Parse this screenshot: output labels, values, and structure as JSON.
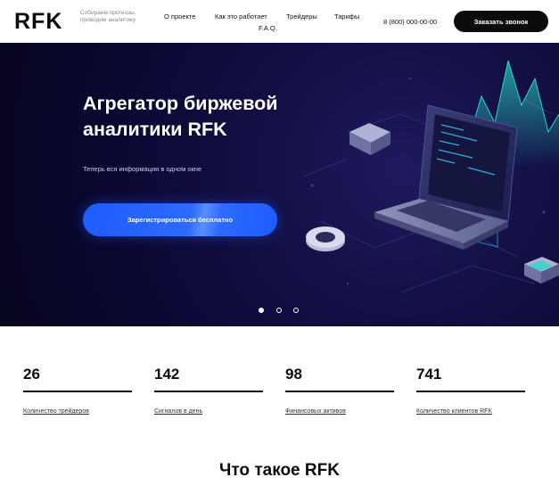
{
  "header": {
    "logo": "RFK",
    "tagline": "Собираем прогнозы, проводим аналитику",
    "nav": [
      "О проекте",
      "Как это работает",
      "Трейдеры",
      "Тарифы",
      "F.A.Q."
    ],
    "phone": "8 (800) 000-00-00",
    "call_button": "Заказать звонок"
  },
  "hero": {
    "title": "Агрегатор биржевой аналитики RFK",
    "subtitle": "Теперь вся информация в одном окне",
    "register_button": "Зарегистрироваться бесплатно",
    "slides_total": 3,
    "active_slide": 1
  },
  "stats": [
    {
      "value": "26",
      "label": "Количество трейдеров"
    },
    {
      "value": "142",
      "label": "Сигналов в день"
    },
    {
      "value": "98",
      "label": "Финансовых активов"
    },
    {
      "value": "741",
      "label": "Количество клиентов RFK"
    }
  ],
  "section": {
    "title": "Что такое RFK"
  },
  "colors": {
    "accent": "#1f5bff",
    "hero_bg": "#0a0830",
    "teal_glow": "#2ad6c4",
    "dark": "#0b0b0b"
  }
}
